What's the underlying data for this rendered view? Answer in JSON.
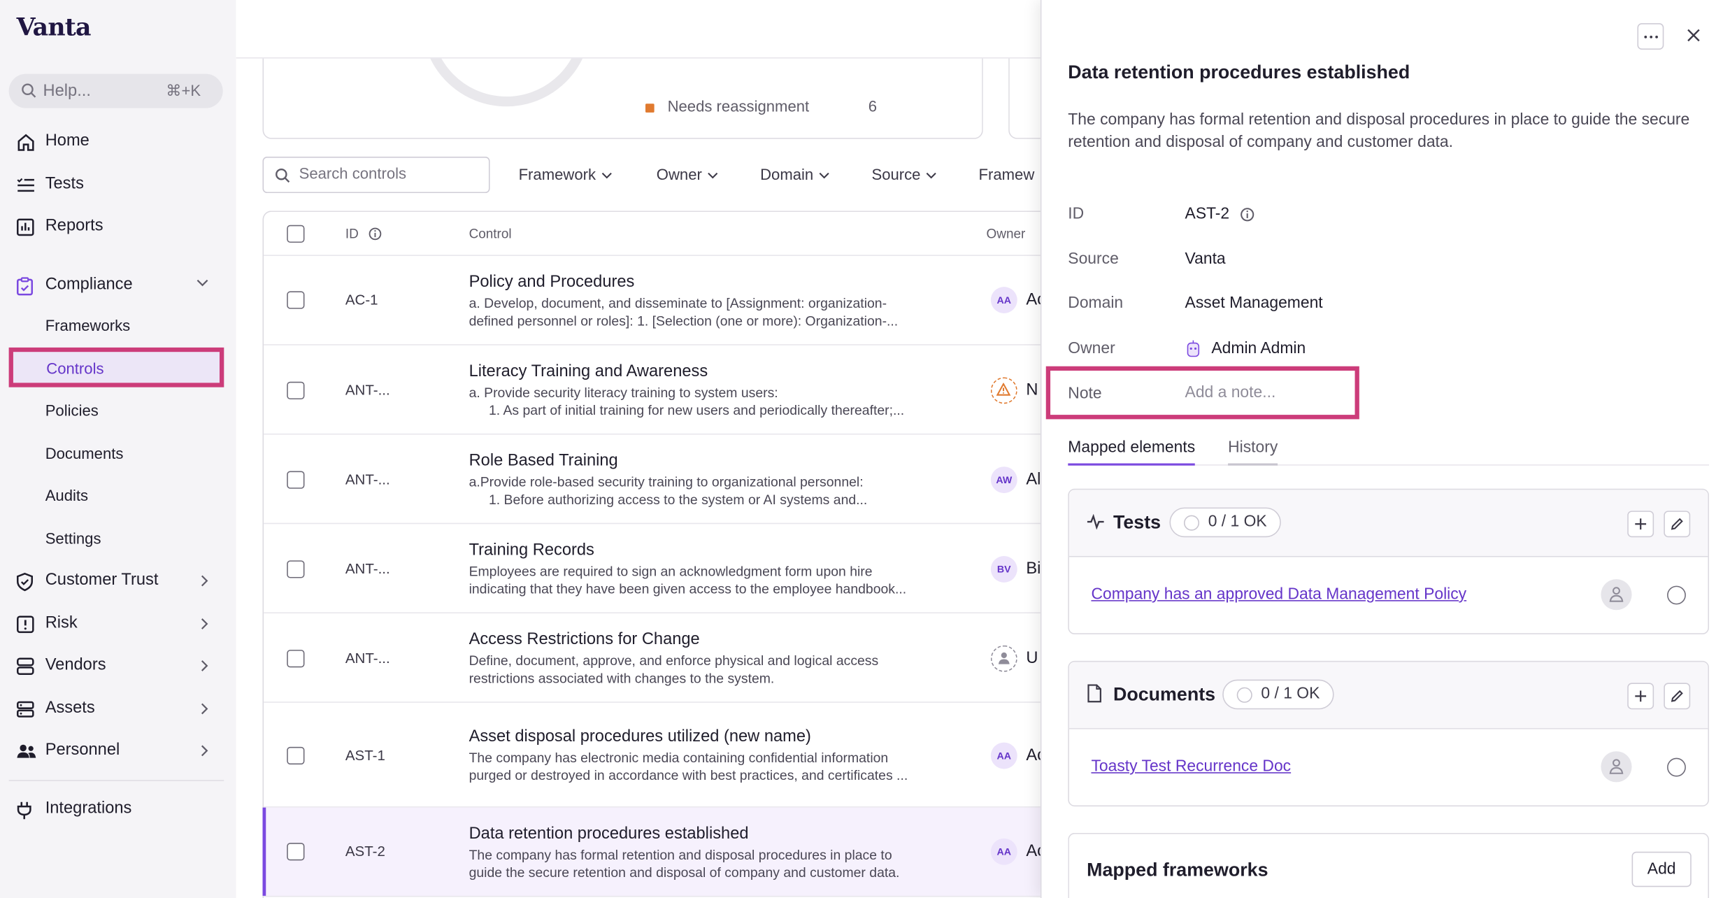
{
  "app": {
    "logo": "Vanta"
  },
  "help": {
    "placeholder": "Help...",
    "shortcut": "⌘+K"
  },
  "nav": {
    "home": "Home",
    "tests": "Tests",
    "reports": "Reports",
    "compliance": "Compliance",
    "compliance_sub": [
      "Frameworks",
      "Controls",
      "Policies",
      "Documents",
      "Audits",
      "Settings"
    ],
    "customer_trust": "Customer Trust",
    "risk": "Risk",
    "vendors": "Vendors",
    "assets": "Assets",
    "personnel": "Personnel",
    "integrations": "Integrations"
  },
  "summary": {
    "legend_label": "Needs reassignment",
    "legend_value": "6"
  },
  "toolbar": {
    "search_placeholder": "Search controls",
    "filters": [
      "Framework",
      "Owner",
      "Domain",
      "Source",
      "Framew"
    ]
  },
  "table": {
    "headers": {
      "id": "ID",
      "control": "Control",
      "owner": "Owner"
    },
    "rows": [
      {
        "id": "AC-1",
        "title": "Policy and Procedures",
        "desc1": "a. Develop, document, and disseminate to [Assignment: organization-",
        "desc2": "defined personnel or roles]: 1. [Selection (one or more): Organization-...",
        "initials": "AA",
        "owner": "Ac"
      },
      {
        "id": "ANT-...",
        "title": "Literacy Training and Awareness",
        "desc1": "a. Provide security literacy training to system users:",
        "desc2": "1. As part of initial training for new users and periodically thereafter;...",
        "initials": "",
        "owner": "N"
      },
      {
        "id": "ANT-...",
        "title": "Role Based Training",
        "desc1": "a.Provide role-based security training to organizational personnel:",
        "desc2": "1. Before authorizing access to the system or AI systems and...",
        "initials": "AW",
        "owner": "Al"
      },
      {
        "id": "ANT-...",
        "title": "Training Records",
        "desc1": "Employees are required to sign an acknowledgment form upon hire",
        "desc2": "indicating that they have been given access to the employee handbook...",
        "initials": "BV",
        "owner": "Bi"
      },
      {
        "id": "ANT-...",
        "title": "Access Restrictions for Change",
        "desc1": "Define, document, approve, and enforce physical and logical access",
        "desc2": "restrictions associated with changes to the system.",
        "initials": "",
        "owner": "U"
      },
      {
        "id": "AST-1",
        "title": "Asset disposal procedures utilized (new name)",
        "desc1": "The company has electronic media containing confidential information",
        "desc2": "purged or destroyed in accordance with best practices, and certificates ...",
        "initials": "AA",
        "owner": "Ac"
      },
      {
        "id": "AST-2",
        "title": "Data retention procedures established",
        "desc1": "The company has formal retention and disposal procedures in place to",
        "desc2": "guide the secure retention and disposal of company and customer data.",
        "initials": "AA",
        "owner": "Ac"
      }
    ]
  },
  "drawer": {
    "title": "Data retention procedures established",
    "description": "The company has formal retention and disposal procedures in place to guide the secure retention and disposal of company and customer data.",
    "fields": {
      "id_label": "ID",
      "id_value": "AST-2",
      "source_label": "Source",
      "source_value": "Vanta",
      "domain_label": "Domain",
      "domain_value": "Asset Management",
      "owner_label": "Owner",
      "owner_value": "Admin Admin",
      "note_label": "Note",
      "note_placeholder": "Add a note..."
    },
    "tabs": [
      "Mapped elements",
      "History"
    ],
    "tests": {
      "title": "Tests",
      "status": "0 / 1 OK",
      "item": "Company has an approved Data Management Policy"
    },
    "documents": {
      "title": "Documents",
      "status": "0 / 1 OK",
      "item": "Toasty Test Recurrence Doc"
    },
    "frameworks": {
      "title": "Mapped frameworks",
      "add_label": "Add"
    }
  },
  "colors": {
    "accent": "#7b49e0",
    "highlight": "#cc3c7a",
    "warning": "#e07a2f"
  }
}
